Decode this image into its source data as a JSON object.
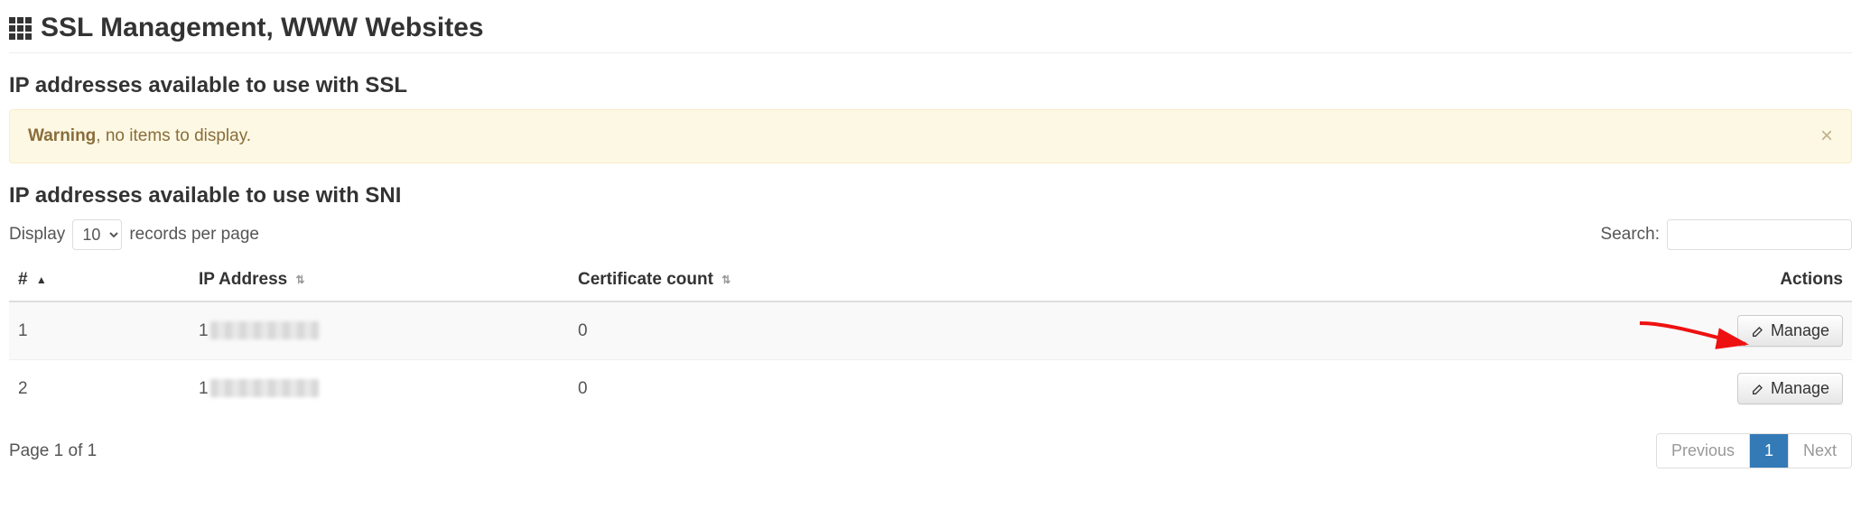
{
  "page": {
    "title": "SSL Management, WWW Websites"
  },
  "ssl_section": {
    "heading": "IP addresses available to use with SSL",
    "alert": {
      "strong": "Warning",
      "rest": ", no items to display."
    }
  },
  "sni_section": {
    "heading": "IP addresses available to use with SNI",
    "display_label_pre": "Display",
    "display_label_post": "records per page",
    "display_options": [
      "10"
    ],
    "display_selected": "10",
    "search_label": "Search:",
    "columns": {
      "index": "#",
      "ip": "IP Address",
      "cert": "Certificate count",
      "actions": "Actions"
    },
    "rows": [
      {
        "index": "1",
        "ip_prefix": "1",
        "ip_rest_obscured": true,
        "cert_count": "0",
        "manage_label": "Manage"
      },
      {
        "index": "2",
        "ip_prefix": "1",
        "ip_rest_obscured": true,
        "cert_count": "0",
        "manage_label": "Manage"
      }
    ],
    "page_info": "Page 1 of 1",
    "pagination": {
      "previous": "Previous",
      "next": "Next",
      "pages": [
        "1"
      ],
      "active": "1"
    }
  }
}
